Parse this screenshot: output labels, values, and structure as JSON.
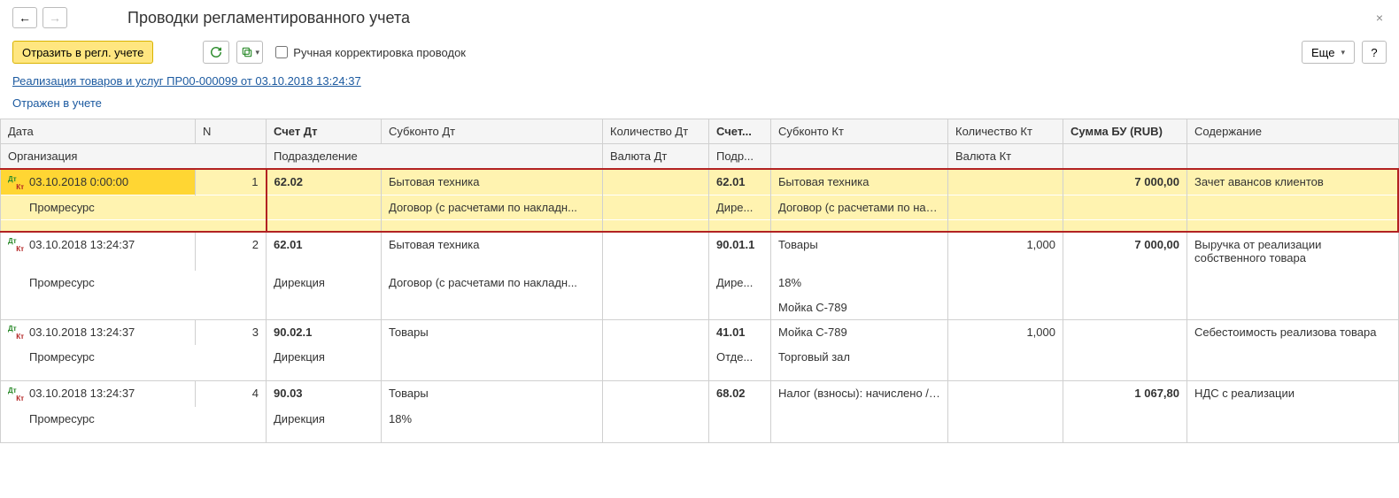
{
  "nav": {
    "back": "←",
    "forward": "→"
  },
  "title": "Проводки регламентированного учета",
  "toolbar": {
    "reflect": "Отразить в регл. учете",
    "manual_label": "Ручная корректировка проводок",
    "more": "Еще",
    "help": "?"
  },
  "doc_link": "Реализация товаров и услуг ПР00-000099 от 03.10.2018 13:24:37",
  "status": "Отражен в учете",
  "headers": {
    "r1": {
      "date": "Дата",
      "n": "N",
      "acct_dt": "Счет Дт",
      "sub_dt": "Субконто Дт",
      "qty_dt": "Количество Дт",
      "acct_kt": "Счет...",
      "sub_kt": "Субконто Кт",
      "qty_kt": "Количество Кт",
      "sum": "Сумма БУ (RUB)",
      "desc": "Содержание"
    },
    "r2": {
      "org": "Организация",
      "dept": "Подразделение",
      "cur_dt": "Валюта Дт",
      "dept_kt": "Подр...",
      "cur_kt": "Валюта Кт"
    }
  },
  "rows": [
    {
      "highlight": true,
      "date": "03.10.2018 0:00:00",
      "n": "1",
      "org": "Промресурс",
      "acct_dt": "62.02",
      "dept_dt": "",
      "sub_dt": [
        "Бытовая техника",
        "Договор (с расчетами по накладн...",
        ""
      ],
      "qty_dt": "",
      "cur_dt": "",
      "acct_kt": "62.01",
      "dept_kt": "Дире...",
      "sub_kt": [
        "Бытовая техника",
        "Договор (с расчетами по накла...",
        ""
      ],
      "qty_kt": "",
      "cur_kt": "",
      "sum": "7 000,00",
      "desc": "Зачет авансов клиентов"
    },
    {
      "date": "03.10.2018 13:24:37",
      "n": "2",
      "org": "Промресурс",
      "acct_dt": "62.01",
      "dept_dt": "Дирекция",
      "sub_dt": [
        "Бытовая техника",
        "Договор (с расчетами по накладн...",
        ""
      ],
      "qty_dt": "",
      "cur_dt": "",
      "acct_kt": "90.01.1",
      "dept_kt": "Дире...",
      "sub_kt": [
        "Товары",
        "18%",
        "Мойка С-789"
      ],
      "qty_kt": "1,000",
      "cur_kt": "",
      "sum": "7 000,00",
      "desc": "Выручка от реализации собственного товара"
    },
    {
      "date": "03.10.2018 13:24:37",
      "n": "3",
      "org": "Промресурс",
      "acct_dt": "90.02.1",
      "dept_dt": "Дирекция",
      "sub_dt": [
        "Товары",
        "",
        ""
      ],
      "qty_dt": "",
      "cur_dt": "",
      "acct_kt": "41.01",
      "dept_kt": "Отде...",
      "sub_kt": [
        "Мойка С-789",
        "Торговый зал",
        ""
      ],
      "qty_kt": "1,000",
      "cur_kt": "",
      "sum": "",
      "desc": "Себестоимость реализова товара"
    },
    {
      "date": "03.10.2018 13:24:37",
      "n": "4",
      "org": "Промресурс",
      "acct_dt": "90.03",
      "dept_dt": "Дирекция",
      "sub_dt": [
        "Товары",
        "18%",
        ""
      ],
      "qty_dt": "",
      "cur_dt": "",
      "acct_kt": "68.02",
      "dept_kt": "",
      "sub_kt": [
        "Налог (взносы): начислено / уп...",
        "",
        ""
      ],
      "qty_kt": "",
      "cur_kt": "",
      "sum": "1 067,80",
      "desc": "НДС с реализации"
    }
  ]
}
